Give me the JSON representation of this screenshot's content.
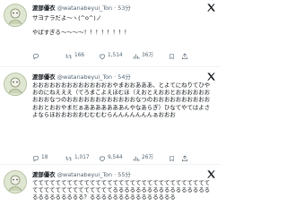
{
  "tweets": [
    {
      "name": "渡部優衣",
      "handle": "@watanabeyui_Ton",
      "time": "53分",
      "text": "サヨナラだよ〜ヽ(^o^)ノ\n\nやばすぎる〜〜〜〜！！！！！！！！",
      "replies": "",
      "retweets": "166",
      "likes": "1,514",
      "views": "36万"
    },
    {
      "name": "渡部優衣",
      "handle": "@watanabeyui_Ton",
      "time": "54分",
      "text": "おおおおおおおおおおおおおおやまおおあああ、とよてにねりてひやおのにねえええ（てろまこよえほむほ（えおとえおおとおおおおおおおおおなつのおおおおおおおおおおおおなつのおおおおおおおおおおおおとおおやまだぁあああああああんやなあらぎ）ひなてやてはよさよならほおおおおおむむむむらんんんんんんんぁおおお",
      "replies": "18",
      "retweets": "1,017",
      "likes": "9,544",
      "views": "26万"
    },
    {
      "name": "渡部優衣",
      "handle": "@watanabeyui_Ton",
      "time": "55分",
      "text": "てててててててててててててててててててててててててててててててててててててててててててててるるるるるるるるるるるるるるるるるるるるるるるるるる？るるるるるるるるるるるるるるる",
      "replies": "",
      "retweets": "",
      "likes": "",
      "views": ""
    }
  ],
  "colors": {
    "text": "#0f1419",
    "muted": "#536471",
    "divider": "#eff3f4"
  },
  "icons": [
    "avatar-icon",
    "x-logo-icon",
    "reply-icon",
    "retweet-icon",
    "like-icon",
    "views-icon",
    "bookmark-icon",
    "share-icon"
  ]
}
